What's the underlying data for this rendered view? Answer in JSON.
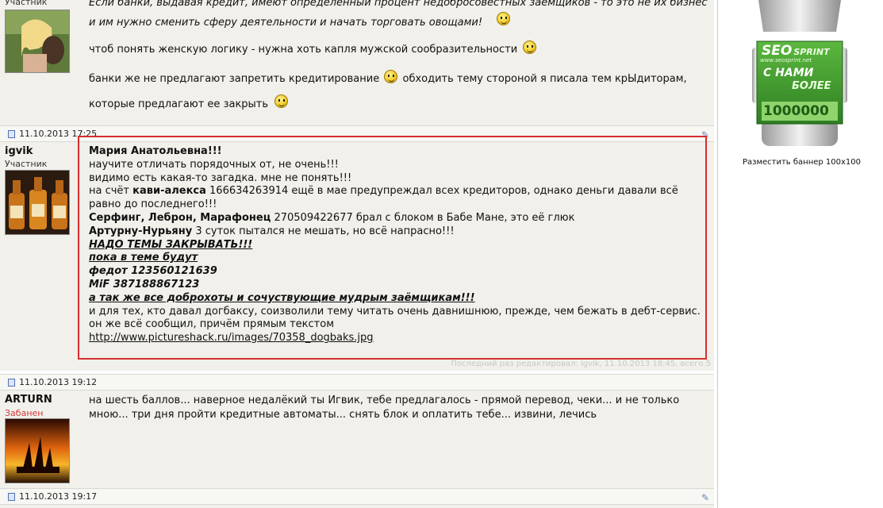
{
  "posts": [
    {
      "author": {
        "rank": "Участник"
      },
      "lines": [
        "Если банки, выдавая кредит, имеют определенный процент недобросовестных заемщиков - то это не их бизнес",
        "и им нужно сменить сферу деятельности и начать торговать овощами!",
        "чтоб понять женскую логику - нужна хоть капля мужской сообразительности",
        "банки же не предлагают запретить кредитирование",
        "обходить тему стороной я писала тем крЫдиторам,",
        "которые предлагают ее закрыть"
      ]
    },
    {
      "date": "11.10.2013 17:25",
      "author": {
        "nick": "igvik",
        "rank": "Участник"
      },
      "lines": {
        "l1": "Мария Анатольевна!!!",
        "l2": "научите отличать порядочных от, не очень!!!",
        "l3": "видимо есть какая-то загадка. мне не понять!!!",
        "l4a": "на счёт ",
        "l4b": "кави-алекса",
        "l4c": " 166634263914 ещё в мае предупреждал всех кредиторов, однако деньги давали всё",
        "l5": "равно до последнего!!!",
        "l6a": "Серфинг, Леброн, Марафонец",
        "l6b": " 270509422677 брал с блоком в Бабе Мане, это её глюк",
        "l7a": "Артурну-Нурьяну",
        "l7b": " 3 суток пытался не мешать, но всё напрасно!!!",
        "l8": "НАДО ТЕМЫ ЗАКРЫВАТЬ!!!",
        "l9": "пока в теме будут",
        "l10": "федот 123560121639",
        "l11": "MiF 387188867123",
        "l12": "а так же все доброхоты и сочуствующие мудрым заёмщикам!!!",
        "l13": "и для тех, кто давал догбаксу, соизволили тему читать очень давнишнюю, прежде, чем бежать в дебт-сервис.",
        "l14": "он же всё сообщил, причём прямым текстом",
        "link": "http://www.pictureshack.ru/images/70358_dogbaks.jpg"
      },
      "edited_note": "Последний раз редактировал: igvik, 11.10.2013 18:45, всего 5"
    },
    {
      "date": "11.10.2013 19:12",
      "author": {
        "nick": "ARTURN",
        "rank": "Забанен"
      },
      "lines": [
        "на шесть баллов... наверное недалёкий ты Игвик, тебе предлагалось - прямой перевод, чеки... и не только",
        "мною... три дня пройти кредитные автоматы... снять блок и оплатить тебе... извини, лечись"
      ]
    },
    {
      "date": "11.10.2013 19:17"
    }
  ],
  "sidebar": {
    "banner": {
      "brand": "SEO",
      "brand2": "SPRINT",
      "url": "www.seosprint.net",
      "line1": "С НАМИ",
      "line2": "БОЛЕЕ",
      "number": "1000000"
    },
    "caption": "Разместить баннер 100x100"
  },
  "colors": {
    "highlight": "#d62e2e",
    "post_bg": "#f1f0eb",
    "banner_green": "#3b9b2b",
    "banned_rank": "#d23b3b"
  }
}
